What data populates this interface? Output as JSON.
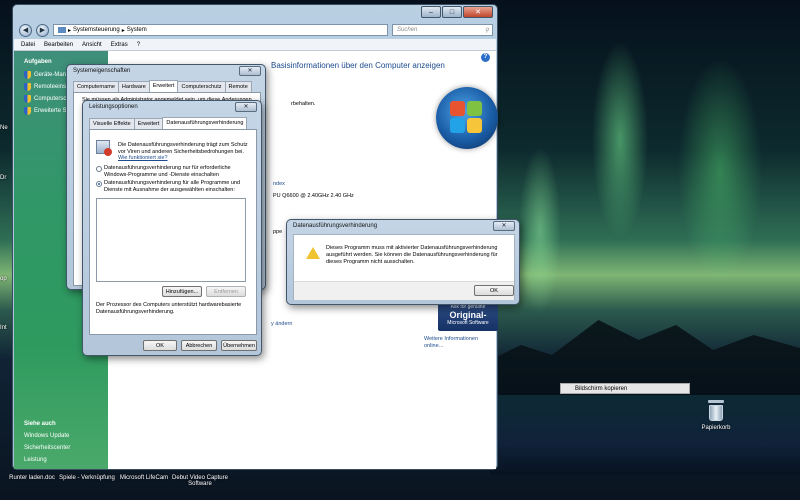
{
  "window": {
    "address_parts": [
      "Systemsteuerung",
      "System"
    ],
    "search_placeholder": "Suchen",
    "menu": [
      "Datei",
      "Bearbeiten",
      "Ansicht",
      "Extras",
      "?"
    ],
    "sidebar": {
      "tasks_title": "Aufgaben",
      "tasks": [
        "Geräte-Manager",
        "Remoteeinstellu",
        "Computerschutz",
        "Erweiterte Syster"
      ],
      "see_also_title": "Siehe auch",
      "see_also": [
        "Windows Update",
        "Sicherheitscenter",
        "Leistung"
      ]
    },
    "content": {
      "heading": "Basisinformationen über den Computer anzeigen",
      "fragment_rights": "rbehalten.",
      "fragment_index": "ndex",
      "processor_line": "PU    Q6600  @ 2.40GHz   2.40 GHz",
      "fragment_group": "ppe",
      "fragment_change": "y ändern",
      "genuine_top": "Ask for genuine",
      "genuine_main": "Original-",
      "genuine_brand": "Microsoft",
      "genuine_bottom": "Software",
      "more_info_link": "Weitere Informationen online..."
    }
  },
  "system_properties": {
    "title": "Systemeigenschaften",
    "tabs": [
      "Computername",
      "Hardware",
      "Erweitert",
      "Computerschutz",
      "Remote"
    ],
    "active_tab": "Erweitert",
    "intro_fragment": "Sie müssen als Administrator angemeldet sein, um diese Änderungen"
  },
  "performance_options": {
    "title": "Leistungsoptionen",
    "tabs": [
      "Visuelle Effekte",
      "Erweitert",
      "Datenausführungsverhinderung"
    ],
    "active_tab": "Datenausführungsverhinderung",
    "description": "Die Datenausführungsverhinderung trägt zum Schutz vor Viren und anderen Sicherheitsbedrohungen bei.",
    "how_link": "Wie funktioniert sie?",
    "option1": "Datenausführungsverhinderung nur für erforderliche Windows-Programme und -Dienste einschalten",
    "option2": "Datenausführungsverhinderung für alle Programme und Dienste mit Ausnahme der ausgewählten einschalten:",
    "selected_option": 2,
    "add_button": "Hinzufügen...",
    "remove_button": "Entfernen",
    "footer": "Der Prozessor des Computers unterstützt hardwarebasierte Datenausführungsverhinderung.",
    "ok": "OK",
    "cancel": "Abbrechen",
    "apply": "Übernehmen"
  },
  "dep_alert": {
    "title": "Datenausführungsverhinderung",
    "message": "Dieses Programm muss mit aktivierter Datenausführungsverhinderung ausgeführt werden. Sie können die Datenausführungsverhinderung für dieses Programm nicht ausschalten.",
    "ok": "OK"
  },
  "desktop": {
    "recycle_bin_label": "Papierkorb",
    "context_item": "Bildschirm kopieren",
    "taskbar_items": [
      "Runter laden.doc",
      "Spiele - Verknüpfung",
      "Microsoft LifeCam",
      "Debut Video Capture Software"
    ],
    "left_edge_fragments": [
      "Ne",
      "Dr",
      "op",
      "Int"
    ]
  },
  "colors": {
    "link_blue": "#1d4b8d",
    "sidebar_green": "#2f9866",
    "window_frame": "#b9cfe2"
  }
}
